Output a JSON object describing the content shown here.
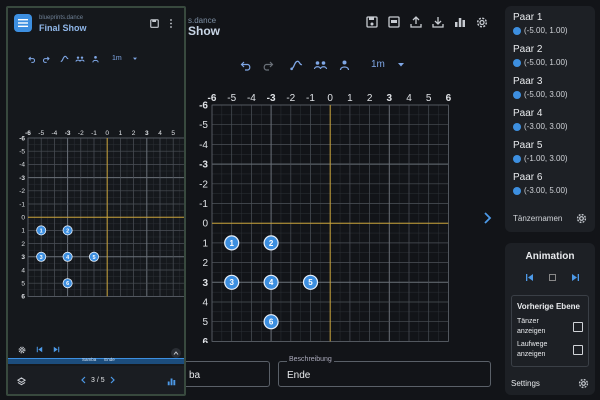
{
  "background": {
    "file_name": "s.dance",
    "show_title": "Show",
    "toolbar_icons": [
      "save-icon",
      "export-pdf-icon",
      "share-icon",
      "download-icon",
      "chart-icon",
      "gear-icon"
    ],
    "zoom": "1m",
    "fields": {
      "music_value": "ba",
      "description_label": "Beschreibung",
      "description_value": "Ende"
    }
  },
  "phone": {
    "file_name": "blueprints.dance",
    "title": "Final Show",
    "zoom": "1m",
    "timeline_tab": "Samba",
    "timeline_tab2": "Ende",
    "page_indicator": "3 / 5"
  },
  "grid": {
    "x_ticks": [
      "-6",
      "-5",
      "-4",
      "-3",
      "-2",
      "-1",
      "0",
      "1",
      "2",
      "3",
      "4",
      "5",
      "6"
    ],
    "y_ticks": [
      "-6",
      "-5",
      "-4",
      "-3",
      "-2",
      "-1",
      "0",
      "1",
      "2",
      "3",
      "4",
      "5",
      "6"
    ],
    "dancers": [
      {
        "n": "1",
        "x": -5,
        "y": 1
      },
      {
        "n": "2",
        "x": -3,
        "y": 1
      },
      {
        "n": "3",
        "x": -5,
        "y": 3
      },
      {
        "n": "4",
        "x": -3,
        "y": 3
      },
      {
        "n": "5",
        "x": -1,
        "y": 3
      },
      {
        "n": "6",
        "x": -3,
        "y": 5
      }
    ]
  },
  "pairs": {
    "items": [
      {
        "name": "Paar 1",
        "pos": "(-5.00, 1.00)"
      },
      {
        "name": "Paar 2",
        "pos": "(-5.00, 1.00)"
      },
      {
        "name": "Paar 3",
        "pos": "(-5.00, 3.00)"
      },
      {
        "name": "Paar 4",
        "pos": "(-3.00, 3.00)"
      },
      {
        "name": "Paar 5",
        "pos": "(-1.00, 3.00)"
      },
      {
        "name": "Paar 6",
        "pos": "(-3.00, 5.00)"
      }
    ],
    "footer_label": "Tänzernamen"
  },
  "animation": {
    "title": "Animation",
    "previous_layer_title": "Vorherige Ebene",
    "show_dancers": "Tänzer anzeigen",
    "show_paths": "Laufwege anzeigen",
    "settings": "Settings"
  },
  "colors": {
    "accent": "#3d8fe0",
    "axis": "#c9a33a",
    "grid": "#4a4f56",
    "grid_bold": "#6a7078",
    "phone_border": "#38493e"
  }
}
